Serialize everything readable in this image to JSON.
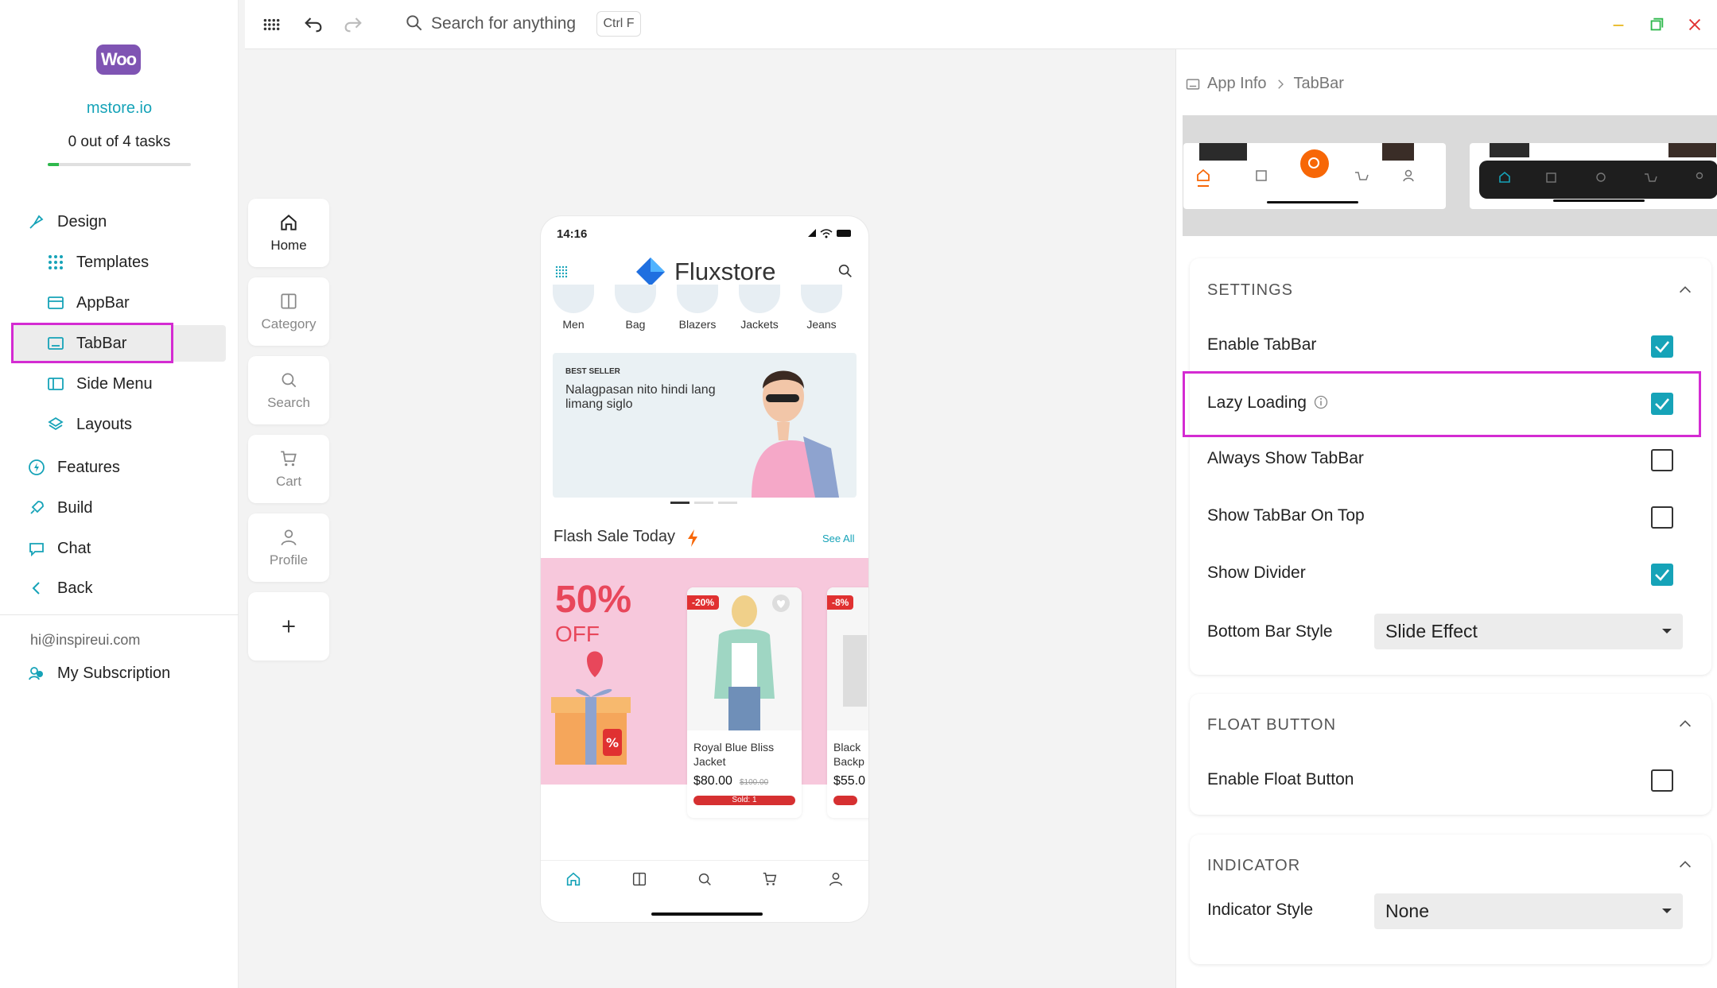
{
  "sidebar": {
    "logo_text": "Woo",
    "store_name": "mstore.io",
    "tasks_label": "0 out of 4 tasks",
    "tasks_progress": 0.08,
    "items": [
      {
        "label": "Design",
        "icon": "brush-icon"
      },
      {
        "label": "Templates",
        "icon": "grid-icon"
      },
      {
        "label": "AppBar",
        "icon": "appbar-icon"
      },
      {
        "label": "TabBar",
        "icon": "tabbar-icon",
        "active": true
      },
      {
        "label": "Side Menu",
        "icon": "side-menu-icon"
      },
      {
        "label": "Layouts",
        "icon": "layers-icon"
      },
      {
        "label": "Features",
        "icon": "bolt-icon"
      },
      {
        "label": "Build",
        "icon": "rocket-icon"
      },
      {
        "label": "Chat",
        "icon": "chat-icon"
      },
      {
        "label": "Back",
        "icon": "chevron-left-icon"
      }
    ],
    "email": "hi@inspireui.com",
    "subscription_label": "My Subscription"
  },
  "topbar": {
    "search_placeholder": "Search for anything",
    "shortcut": "Ctrl F"
  },
  "preview_tabs": [
    {
      "label": "Home",
      "icon": "home-icon",
      "active": true
    },
    {
      "label": "Category",
      "icon": "category-icon"
    },
    {
      "label": "Search",
      "icon": "search-icon"
    },
    {
      "label": "Cart",
      "icon": "cart-icon"
    },
    {
      "label": "Profile",
      "icon": "profile-icon"
    },
    {
      "label": "",
      "icon": "plus-icon"
    }
  ],
  "phone": {
    "time": "14:16",
    "app_title": "Fluxstore",
    "categories": [
      "Men",
      "Bag",
      "Blazers",
      "Jackets",
      "Jeans"
    ],
    "banner_tag": "BEST SELLER",
    "banner_text": "Nalagpasan nito hindi lang limang siglo",
    "flash_title": "Flash Sale Today",
    "see_all": "See All",
    "sale_percent": "50%",
    "sale_off": "OFF",
    "products": [
      {
        "badge": "-20%",
        "name": "Royal Blue Bliss Jacket",
        "price": "$80.00",
        "old_price": "$100.00",
        "sold": "Sold: 1"
      },
      {
        "badge": "-8%",
        "name": "Black Backp",
        "price": "$55.0",
        "old_price": "",
        "sold": ""
      }
    ]
  },
  "panel": {
    "breadcrumb": [
      "App Info",
      "TabBar"
    ],
    "settings": {
      "title": "SETTINGS",
      "enable_tabbar": {
        "label": "Enable TabBar",
        "checked": true
      },
      "lazy_loading": {
        "label": "Lazy Loading",
        "checked": true
      },
      "always_show": {
        "label": "Always Show TabBar",
        "checked": false
      },
      "show_on_top": {
        "label": "Show TabBar On Top",
        "checked": false
      },
      "show_divider": {
        "label": "Show Divider",
        "checked": true
      },
      "bottom_bar_style": {
        "label": "Bottom Bar Style",
        "value": "Slide Effect"
      }
    },
    "float_button": {
      "title": "FLOAT BUTTON",
      "enable": {
        "label": "Enable Float Button",
        "checked": false
      }
    },
    "indicator": {
      "title": "INDICATOR",
      "style": {
        "label": "Indicator Style",
        "value": "None"
      }
    }
  },
  "colors": {
    "accent": "#16a3b8",
    "highlight": "#d42bd2",
    "woo": "#7f54b3",
    "sale": "#e8475b"
  }
}
